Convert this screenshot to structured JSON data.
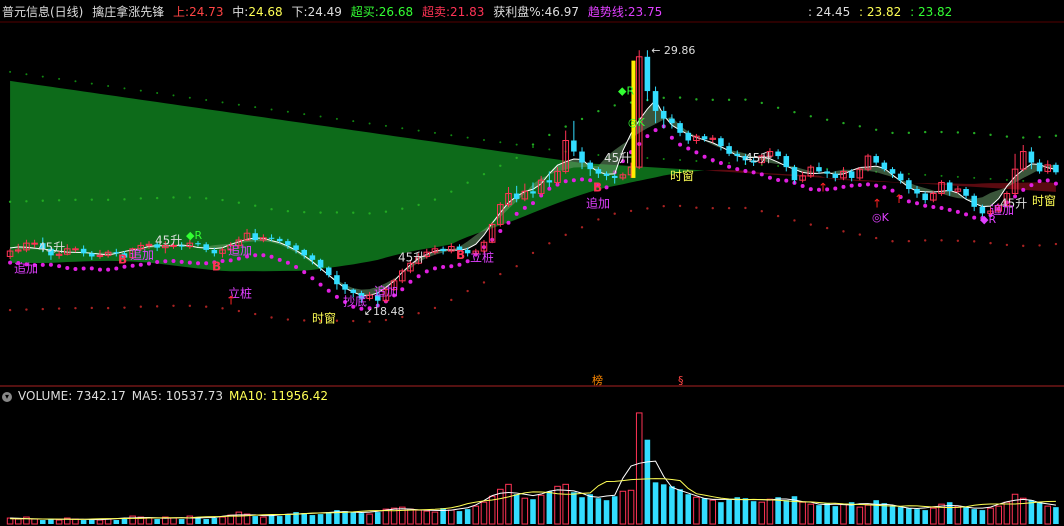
{
  "header": {
    "stock": "普元信息(日线)",
    "indicator": "擒庄拿涨先锋",
    "upper_label": "上:",
    "upper_value": "24.73",
    "mid_label": "中:",
    "mid_value": "24.68",
    "lower_label": "下:",
    "lower_value": "24.49",
    "overbuy_label": "超买:",
    "overbuy_value": "26.68",
    "oversell_label": "超卖:",
    "oversell_value": "21.83",
    "profit_label": "获利盘%:",
    "profit_value": "46.97",
    "trend_label": "趋势线:",
    "trend_value": "23.75",
    "right_1": ": 24.45",
    "right_2": ": 23.82",
    "right_3": ": 23.82"
  },
  "volume_header": {
    "label": "VOLUME: 7342.17",
    "ma5": "MA5: 10537.73",
    "ma10": "MA10: 11956.42"
  },
  "colors": {
    "up": "#ff3355",
    "down": "#33ddff",
    "bg": "#000000",
    "cloud_green": "#0d6b1a",
    "cloud_red": "#5a0a10",
    "dots": "#e020e0",
    "label_purple": "#e040ff",
    "ma5": "#ffffff",
    "ma10": "#ffff55"
  },
  "chart_data": {
    "type": "candlestick",
    "price_ylim": [
      15.6,
      31.2
    ],
    "max_price_label": "29.86",
    "min_price_label": "18.48",
    "candles": [
      [
        20.72,
        20.96,
        21.06,
        20.61
      ],
      [
        20.96,
        21.01,
        21.28,
        20.86
      ],
      [
        21.01,
        21.31,
        21.46,
        20.91
      ],
      [
        21.31,
        21.31,
        21.46,
        21.11
      ],
      [
        21.31,
        21.06,
        21.56,
        20.91
      ],
      [
        21.06,
        20.77,
        21.16,
        20.57
      ],
      [
        20.77,
        20.82,
        20.96,
        20.62
      ],
      [
        20.82,
        21.06,
        21.26,
        20.77
      ],
      [
        21.06,
        21.06,
        21.16,
        20.91
      ],
      [
        21.06,
        20.86,
        21.21,
        20.72
      ],
      [
        20.86,
        20.72,
        20.96,
        20.57
      ],
      [
        20.72,
        20.77,
        21.01,
        20.62
      ],
      [
        20.77,
        20.91,
        21.01,
        20.67
      ],
      [
        20.91,
        20.86,
        21.06,
        20.72
      ],
      [
        20.86,
        20.67,
        20.96,
        20.52
      ],
      [
        20.67,
        21.06,
        21.11,
        20.62
      ],
      [
        21.06,
        21.21,
        21.35,
        20.96
      ],
      [
        21.21,
        21.26,
        21.4,
        21.06
      ],
      [
        21.26,
        21.11,
        21.35,
        20.96
      ],
      [
        21.11,
        21.21,
        21.4,
        20.86
      ],
      [
        21.21,
        21.21,
        21.35,
        21.06
      ],
      [
        21.21,
        21.16,
        21.35,
        21.01
      ],
      [
        21.16,
        21.31,
        21.45,
        21.06
      ],
      [
        21.31,
        21.26,
        21.4,
        21.16
      ],
      [
        21.26,
        21.01,
        21.35,
        20.91
      ],
      [
        21.01,
        20.86,
        21.11,
        20.72
      ],
      [
        20.86,
        21.01,
        21.11,
        20.67
      ],
      [
        21.01,
        21.21,
        21.35,
        20.91
      ],
      [
        21.21,
        21.45,
        21.6,
        21.06
      ],
      [
        21.45,
        21.75,
        21.94,
        21.4
      ],
      [
        21.75,
        21.45,
        21.94,
        21.35
      ],
      [
        21.45,
        21.55,
        21.7,
        21.35
      ],
      [
        21.55,
        21.5,
        21.7,
        21.4
      ],
      [
        21.5,
        21.4,
        21.6,
        21.31
      ],
      [
        21.4,
        21.21,
        21.5,
        21.06
      ],
      [
        21.21,
        21.01,
        21.31,
        20.86
      ],
      [
        21.01,
        20.77,
        21.06,
        20.62
      ],
      [
        20.77,
        20.57,
        20.86,
        20.37
      ],
      [
        20.57,
        20.23,
        20.62,
        20.08
      ],
      [
        20.23,
        19.89,
        20.28,
        19.79
      ],
      [
        19.89,
        19.49,
        20.08,
        19.25
      ],
      [
        19.49,
        19.25,
        19.59,
        19.06
      ],
      [
        19.25,
        19.1,
        19.3,
        18.91
      ],
      [
        19.1,
        18.86,
        19.2,
        18.66
      ],
      [
        18.86,
        19.01,
        19.15,
        18.76
      ],
      [
        19.01,
        18.76,
        19.15,
        18.48
      ],
      [
        18.76,
        19.25,
        19.35,
        18.66
      ],
      [
        19.25,
        19.64,
        19.74,
        19.2
      ],
      [
        19.64,
        20.08,
        20.18,
        19.54
      ],
      [
        20.08,
        20.42,
        20.57,
        19.98
      ],
      [
        20.42,
        20.72,
        20.86,
        20.37
      ],
      [
        20.72,
        20.91,
        21.06,
        20.62
      ],
      [
        20.91,
        21.06,
        21.21,
        20.81
      ],
      [
        21.06,
        20.96,
        21.16,
        20.81
      ],
      [
        20.96,
        21.16,
        21.31,
        20.86
      ],
      [
        21.16,
        21.01,
        21.26,
        20.91
      ],
      [
        21.01,
        20.86,
        21.11,
        20.72
      ],
      [
        20.86,
        20.96,
        21.06,
        20.77
      ],
      [
        20.96,
        21.35,
        21.45,
        20.86
      ],
      [
        21.35,
        22.14,
        22.23,
        21.31
      ],
      [
        22.14,
        23.02,
        23.12,
        22.04
      ],
      [
        23.02,
        23.51,
        23.8,
        22.92
      ],
      [
        23.51,
        23.27,
        23.85,
        23.12
      ],
      [
        23.27,
        23.61,
        23.95,
        23.17
      ],
      [
        23.61,
        23.51,
        24.0,
        23.32
      ],
      [
        23.51,
        24.1,
        24.29,
        23.41
      ],
      [
        24.1,
        24.0,
        24.49,
        23.8
      ],
      [
        24.0,
        24.49,
        24.68,
        23.9
      ],
      [
        24.49,
        25.86,
        26.3,
        24.39
      ],
      [
        25.86,
        25.37,
        26.73,
        25.17
      ],
      [
        25.37,
        24.88,
        25.56,
        24.59
      ],
      [
        24.88,
        24.59,
        24.98,
        24.29
      ],
      [
        24.59,
        24.39,
        24.68,
        24.2
      ],
      [
        24.39,
        24.29,
        24.49,
        24.1
      ],
      [
        24.29,
        24.2,
        24.39,
        23.95
      ],
      [
        24.2,
        24.34,
        24.44,
        24.1
      ],
      [
        24.34,
        24.68,
        24.88,
        24.2
      ],
      [
        24.68,
        29.57,
        29.86,
        24.59
      ],
      [
        29.57,
        28.05,
        29.86,
        27.61
      ],
      [
        28.05,
        27.17,
        28.25,
        26.63
      ],
      [
        27.17,
        26.83,
        27.37,
        26.39
      ],
      [
        26.83,
        26.63,
        27.02,
        26.39
      ],
      [
        26.63,
        26.2,
        26.73,
        26.05
      ],
      [
        26.2,
        25.86,
        26.3,
        25.71
      ],
      [
        25.86,
        26.05,
        26.15,
        25.71
      ],
      [
        26.05,
        25.91,
        26.15,
        25.81
      ],
      [
        25.91,
        25.96,
        26.1,
        25.76
      ],
      [
        25.96,
        25.61,
        26.05,
        25.42
      ],
      [
        25.61,
        25.27,
        25.76,
        25.17
      ],
      [
        25.27,
        25.17,
        25.42,
        24.93
      ],
      [
        25.17,
        24.98,
        25.27,
        24.78
      ],
      [
        24.98,
        24.88,
        25.08,
        24.73
      ],
      [
        24.88,
        25.17,
        25.27,
        24.78
      ],
      [
        25.17,
        25.37,
        25.52,
        25.08
      ],
      [
        25.37,
        25.17,
        25.47,
        25.03
      ],
      [
        25.17,
        24.68,
        25.27,
        24.49
      ],
      [
        24.68,
        24.1,
        24.78,
        23.95
      ],
      [
        24.1,
        24.29,
        24.49,
        24.0
      ],
      [
        24.29,
        24.68,
        24.78,
        24.2
      ],
      [
        24.68,
        24.49,
        24.88,
        24.39
      ],
      [
        24.49,
        24.39,
        24.59,
        24.2
      ],
      [
        24.39,
        24.2,
        24.49,
        24.05
      ],
      [
        24.2,
        24.49,
        24.68,
        24.1
      ],
      [
        24.49,
        24.2,
        24.59,
        24.05
      ],
      [
        24.2,
        24.59,
        24.68,
        24.1
      ],
      [
        24.59,
        25.17,
        25.27,
        24.49
      ],
      [
        25.17,
        24.88,
        25.27,
        24.78
      ],
      [
        24.88,
        24.59,
        24.98,
        24.49
      ],
      [
        24.59,
        24.39,
        24.68,
        24.2
      ],
      [
        24.39,
        24.1,
        24.49,
        23.95
      ],
      [
        24.1,
        23.71,
        24.2,
        23.51
      ],
      [
        23.71,
        23.51,
        23.85,
        23.32
      ],
      [
        23.51,
        23.22,
        23.61,
        23.07
      ],
      [
        23.22,
        23.51,
        23.61,
        23.12
      ],
      [
        23.51,
        24.0,
        24.1,
        23.41
      ],
      [
        24.0,
        23.61,
        24.1,
        23.41
      ],
      [
        23.61,
        23.71,
        23.85,
        23.51
      ],
      [
        23.71,
        23.41,
        23.8,
        23.27
      ],
      [
        23.41,
        22.92,
        23.51,
        22.73
      ],
      [
        22.92,
        22.63,
        23.02,
        22.48
      ],
      [
        22.63,
        22.73,
        22.92,
        22.53
      ],
      [
        22.73,
        22.97,
        23.07,
        22.63
      ],
      [
        22.97,
        23.51,
        23.61,
        22.87
      ],
      [
        23.51,
        24.59,
        25.27,
        23.41
      ],
      [
        24.59,
        25.37,
        25.66,
        24.49
      ],
      [
        25.37,
        24.88,
        25.56,
        24.59
      ],
      [
        24.88,
        24.49,
        25.03,
        24.39
      ],
      [
        24.49,
        24.78,
        24.98,
        24.39
      ],
      [
        24.78,
        24.45,
        24.88,
        24.35
      ]
    ],
    "volume_ylim": [
      0,
      120
    ],
    "volumes": [
      6,
      5,
      7,
      5,
      4,
      5,
      4,
      6,
      5,
      4,
      5,
      4,
      5,
      4,
      6,
      8,
      7,
      6,
      5,
      7,
      6,
      5,
      8,
      6,
      5,
      6,
      7,
      9,
      12,
      10,
      8,
      7,
      9,
      8,
      10,
      12,
      11,
      9,
      10,
      12,
      14,
      13,
      12,
      11,
      10,
      12,
      15,
      16,
      17,
      15,
      14,
      13,
      12,
      16,
      14,
      13,
      15,
      18,
      22,
      28,
      35,
      40,
      30,
      26,
      25,
      29,
      33,
      38,
      40,
      32,
      27,
      30,
      26,
      24,
      28,
      33,
      34,
      112,
      85,
      42,
      40,
      38,
      35,
      30,
      27,
      26,
      24,
      22,
      25,
      27,
      26,
      23,
      22,
      25,
      27,
      24,
      28,
      22,
      20,
      19,
      21,
      18,
      20,
      22,
      17,
      19,
      24,
      21,
      18,
      17,
      16,
      15,
      14,
      16,
      20,
      22,
      18,
      17,
      15,
      14,
      16,
      18,
      22,
      30,
      26,
      24,
      22,
      18,
      17
    ],
    "annotations": [
      "追加",
      "追加",
      "追加",
      "立桩",
      "时窗",
      "45升",
      "45升",
      "45升",
      "45升",
      "抄底",
      "18.48",
      "立桩",
      "追加",
      "时窗",
      "追加",
      "时窗",
      "B",
      "R",
      "K",
      "R"
    ]
  }
}
